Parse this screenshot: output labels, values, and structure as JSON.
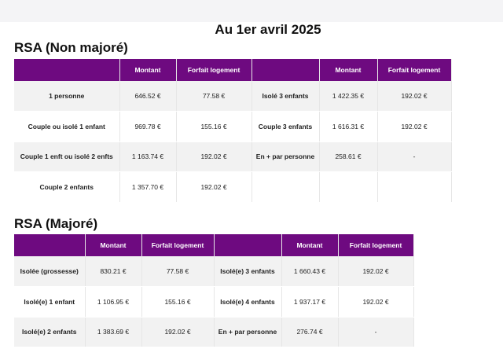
{
  "page_title": "Au 1er avril 2025",
  "sections": [
    {
      "title": "RSA (Non majoré)",
      "headers": [
        "",
        "Montant",
        "Forfait logement",
        "",
        "Montant",
        "Forfait logement"
      ],
      "rows": [
        [
          "1 personne",
          "646.52 €",
          "77.58 €",
          "Isolé 3 enfants",
          "1 422.35 €",
          "192.02 €"
        ],
        [
          "Couple ou isolé 1 enfant",
          "969.78 €",
          "155.16 €",
          "Couple 3 enfants",
          "1 616.31 €",
          "192.02 €"
        ],
        [
          "Couple 1 enft ou isolé 2 enfts",
          "1 163.74 €",
          "192.02 €",
          "En + par personne",
          "258.61 €",
          "-"
        ],
        [
          "Couple 2 enfants",
          "1 357.70 €",
          "192.02 €",
          "",
          "",
          ""
        ]
      ]
    },
    {
      "title": "RSA (Majoré)",
      "headers": [
        "",
        "Montant",
        "Forfait logement",
        "",
        "Montant",
        "Forfait logement"
      ],
      "rows": [
        [
          "Isolée (grossesse)",
          "830.21 €",
          "77.58 €",
          "Isolé(e) 3 enfants",
          "1 660.43 €",
          "192.02 €"
        ],
        [
          "Isolé(e) 1 enfant",
          "1 106.95 €",
          "155.16 €",
          "Isolé(e) 4 enfants",
          "1 937.17 €",
          "192.02 €"
        ],
        [
          "Isolé(e) 2 enfants",
          "1 383.69 €",
          "192.02 €",
          "En + par personne",
          "276.74 €",
          "-"
        ]
      ]
    }
  ],
  "colors": {
    "header_bg": "#6e0a80",
    "row_alt": "#f2f2f2"
  }
}
